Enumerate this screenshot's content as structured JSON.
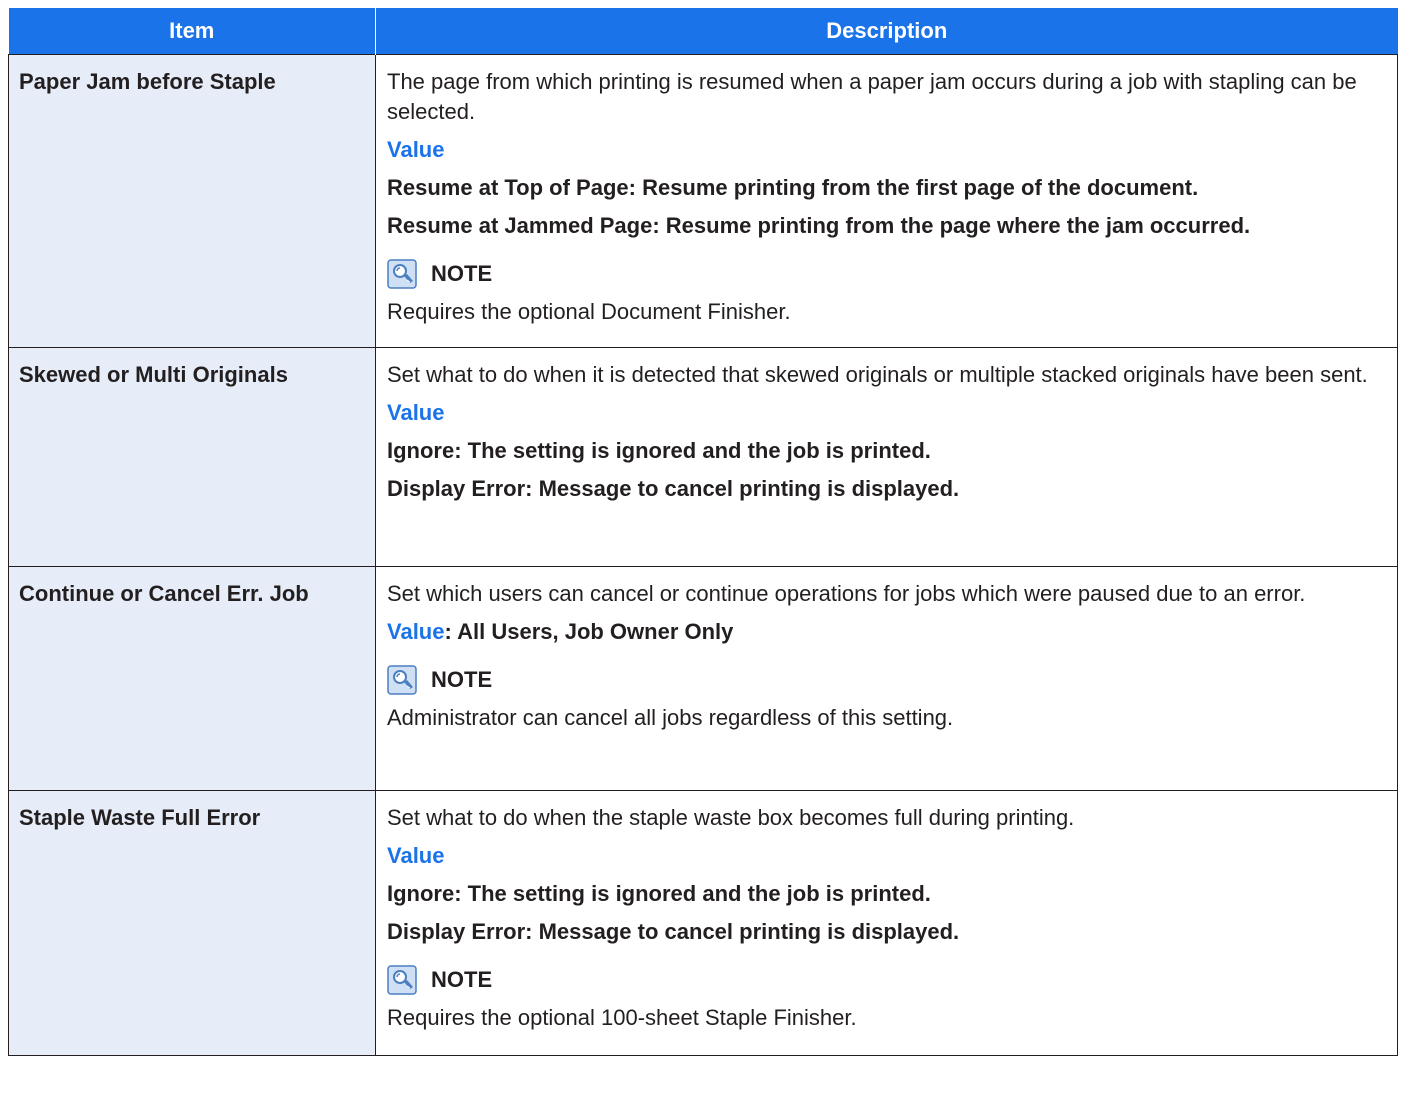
{
  "header": {
    "item": "Item",
    "description": "Description"
  },
  "value_label": "Value",
  "note_label": "NOTE",
  "rows": [
    {
      "item": "Paper Jam before Staple",
      "description": "The page from which printing is resumed when a paper jam occurs during a job with stapling can be selected.",
      "values": [
        "Resume at Top of Page: Resume printing from the first page of the document.",
        "Resume at Jammed Page: Resume printing from the page where the jam occurred."
      ],
      "note": "Requires the optional Document Finisher."
    },
    {
      "item": "Skewed or Multi Originals",
      "description": "Set what to do when it is detected that skewed originals or multiple stacked originals have been sent.",
      "values": [
        "Ignore: The setting is ignored and the job is printed.",
        "Display Error: Message to cancel printing is displayed."
      ]
    },
    {
      "item": "Continue or Cancel Err. Job",
      "description": "Set which users can cancel or continue operations for jobs which were paused due to an error.",
      "inline_value": ": All Users, Job Owner Only",
      "note": "Administrator can cancel all jobs regardless of this setting."
    },
    {
      "item": "Staple Waste Full Error",
      "description": "Set what to do when the staple waste box becomes full during printing.",
      "values": [
        "Ignore: The setting is ignored and the job is printed.",
        "Display Error: Message to cancel printing is displayed."
      ],
      "note": "Requires the optional 100-sheet Staple Finisher."
    }
  ]
}
